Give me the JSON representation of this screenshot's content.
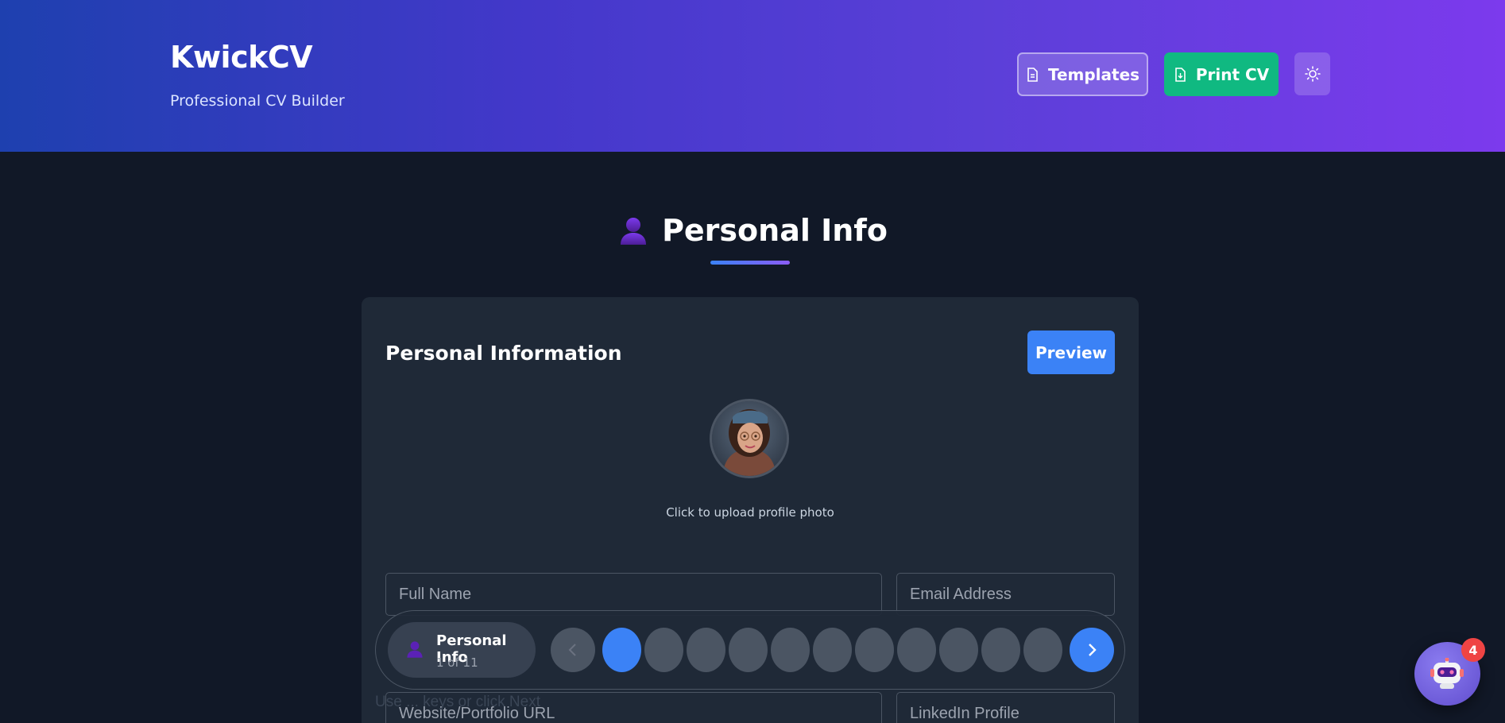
{
  "header": {
    "title": "KwickCV",
    "subtitle": "Professional CV Builder",
    "templates_label": "Templates",
    "print_label": "Print CV",
    "theme_icon": "sun-icon"
  },
  "section": {
    "icon": "person-icon",
    "title": "Personal Info"
  },
  "card": {
    "title": "Personal Information",
    "preview_label": "Preview",
    "upload_hint": "Click to upload profile photo",
    "fields": {
      "full_name": {
        "placeholder": "Full Name",
        "value": ""
      },
      "email": {
        "placeholder": "Email Address",
        "value": ""
      },
      "website": {
        "placeholder": "Website/Portfolio URL",
        "value": ""
      },
      "linkedin": {
        "placeholder": "LinkedIn Profile",
        "value": ""
      }
    }
  },
  "faint_hint": "Use ... keys or click Next",
  "stepper": {
    "current_label": "Personal Info",
    "current_count": "1 of 11",
    "total_steps": 11,
    "active_step": 1
  },
  "chatbot": {
    "icon": "robot-icon",
    "badge": "4"
  },
  "colors": {
    "accent": "#3b82f6",
    "print": "#10b981",
    "background": "#111827",
    "card": "#1f2937",
    "badge": "#ef4444"
  }
}
